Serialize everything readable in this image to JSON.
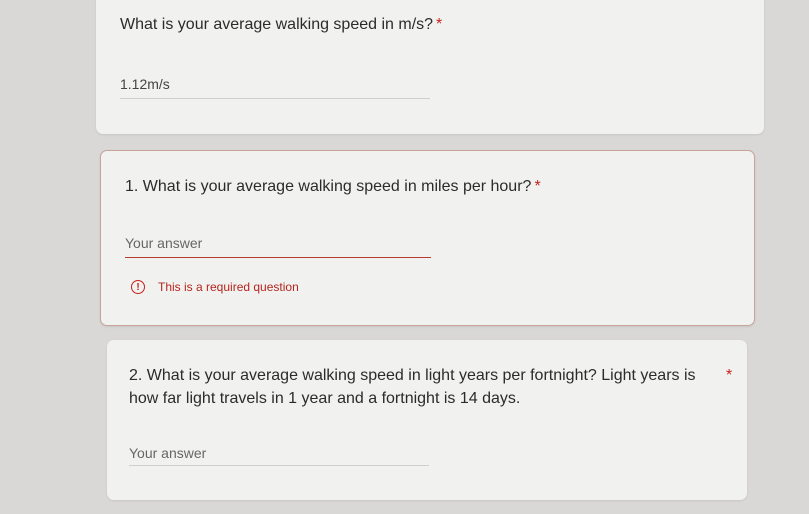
{
  "q0": {
    "title": "What is your average walking speed in m/s?",
    "required_mark": "*",
    "answer": "1.12m/s"
  },
  "q1": {
    "title": "1. What is your average walking speed in miles per hour?",
    "required_mark": "*",
    "placeholder": "Your answer",
    "error": "This is a required question",
    "error_icon": "!"
  },
  "q2": {
    "title_line1": "2. What is your average walking speed in light years per fortnight?  Light years is",
    "title_line2": "how far light travels in 1 year and a fortnight is 14 days.",
    "required_mark": "*",
    "placeholder": "Your answer"
  },
  "colors": {
    "background": "#d9d8d6",
    "card": "#f1f1ef",
    "error": "#c5221f"
  }
}
